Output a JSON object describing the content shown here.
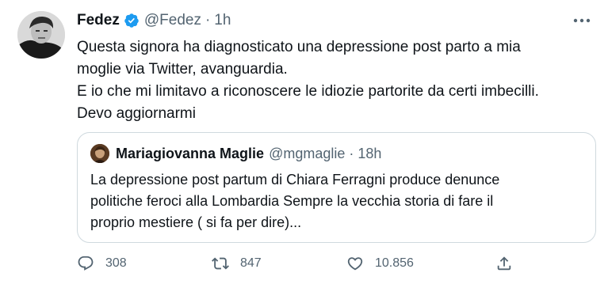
{
  "author": {
    "name": "Fedez",
    "handle": "@Fedez",
    "separator": "·",
    "time": "1h"
  },
  "tweet": {
    "lines": [
      "Questa signora ha diagnosticato una depressione post parto a mia",
      "moglie via Twitter, avanguardia.",
      "E io che mi limitavo a riconoscere le idiozie partorite da certi imbecilli.",
      "Devo aggiornarmi"
    ]
  },
  "quote": {
    "name": "Mariagiovanna Maglie",
    "handle": "@mgmaglie",
    "separator": "·",
    "time": "18h",
    "lines": [
      "La depressione post partum di Chiara Ferragni produce denunce",
      "politiche feroci alla Lombardia Sempre la vecchia storia di fare il",
      "proprio mestiere ( si fa per dire)..."
    ]
  },
  "actions": {
    "replies": "308",
    "retweets": "847",
    "likes": "10.856"
  },
  "colors": {
    "text": "#0f1419",
    "secondary": "#536471",
    "verified": "#1d9bf0",
    "border": "#cfd9de"
  },
  "icons": [
    "verified-badge-icon",
    "more-icon",
    "reply-icon",
    "retweet-icon",
    "like-icon",
    "share-icon"
  ]
}
